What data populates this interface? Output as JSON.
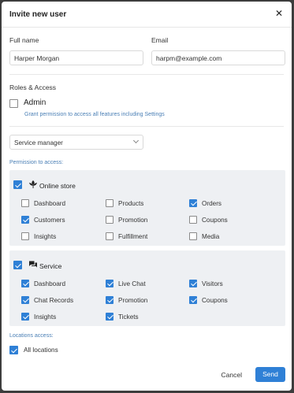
{
  "modal": {
    "title": "Invite new user",
    "close_glyph": "✕"
  },
  "form": {
    "full_name_label": "Full name",
    "full_name_value": "Harper Morgan",
    "email_label": "Email",
    "email_value": "harpm@example.com"
  },
  "roles": {
    "heading": "Roles & Access",
    "admin_label": "Admin",
    "admin_checked": false,
    "admin_hint": "Grant permission to access all features including Settings",
    "role_select_value": "Service manager"
  },
  "permissions": {
    "caption": "Permission to access:",
    "online_store": {
      "label": "Online store",
      "icon": "leaf-icon",
      "checked": true,
      "items": [
        {
          "label": "Dashboard",
          "checked": false
        },
        {
          "label": "Products",
          "checked": false
        },
        {
          "label": "Orders",
          "checked": true
        },
        {
          "label": "Customers",
          "checked": true
        },
        {
          "label": "Promotion",
          "checked": false
        },
        {
          "label": "Coupons",
          "checked": false
        },
        {
          "label": "Insights",
          "checked": false
        },
        {
          "label": "Fulfillment",
          "checked": false
        },
        {
          "label": "Media",
          "checked": false
        }
      ]
    },
    "service": {
      "label": "Service",
      "icon": "chat-icon",
      "checked": true,
      "items": [
        {
          "label": "Dashboard",
          "checked": true
        },
        {
          "label": "Live Chat",
          "checked": true
        },
        {
          "label": "Visitors",
          "checked": true
        },
        {
          "label": "Chat Records",
          "checked": true
        },
        {
          "label": "Promotion",
          "checked": true
        },
        {
          "label": "Coupons",
          "checked": true
        },
        {
          "label": "Insights",
          "checked": true
        },
        {
          "label": "Tickets",
          "checked": true
        }
      ]
    }
  },
  "locations": {
    "caption": "Locations access:",
    "all_label": "All locations",
    "all_checked": true
  },
  "actions": {
    "cancel_label": "Cancel",
    "send_label": "Send"
  },
  "colors": {
    "accent": "#2f80d6",
    "panel_bg": "#eef0f3",
    "caption": "#4a7fb5"
  }
}
